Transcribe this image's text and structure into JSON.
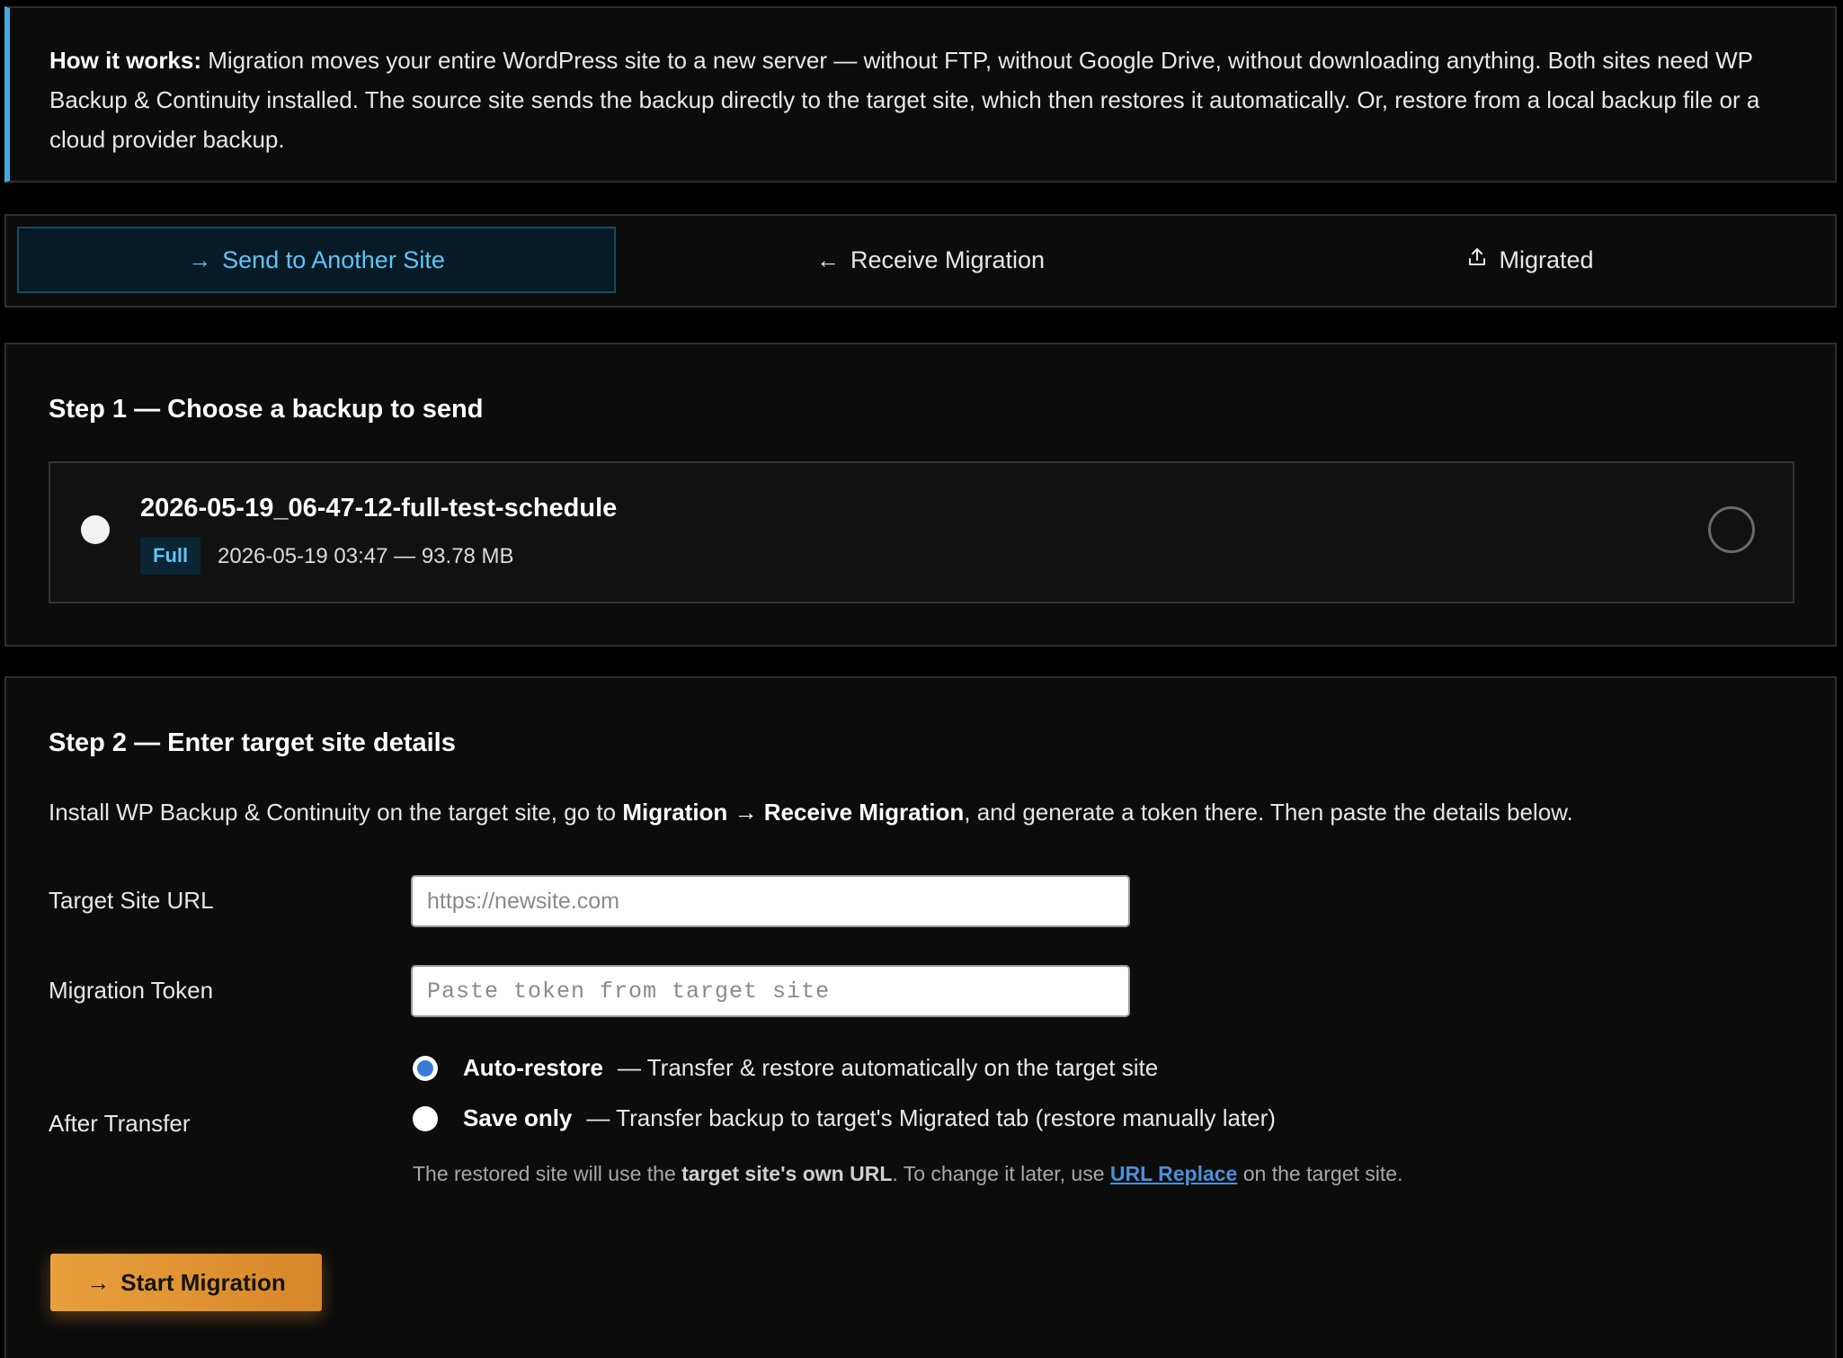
{
  "info": {
    "label": "How it works:",
    "text": " Migration moves your entire WordPress site to a new server — without FTP, without Google Drive, without downloading anything. Both sites need WP Backup & Continuity installed. The source site sends the backup directly to the target site, which then restores it automatically. Or, restore from a local backup file or a cloud provider backup."
  },
  "tabs": [
    {
      "label": "Send to Another Site",
      "icon": "arrow-right-icon",
      "glyph": "→",
      "active": true
    },
    {
      "label": "Receive Migration",
      "icon": "arrow-left-icon",
      "glyph": "←",
      "active": false
    },
    {
      "label": "Migrated",
      "icon": "upload-icon",
      "glyph": "⇪",
      "active": false
    }
  ],
  "step1": {
    "title": "Step 1 — Choose a backup to send",
    "backup": {
      "name": "2026-05-19_06-47-12-full-test-schedule",
      "badge": "Full",
      "meta": "2026-05-19 03:47 — 93.78 MB"
    }
  },
  "step2": {
    "title": "Step 2 — Enter target site details",
    "desc_prefix": "Install WP Backup & Continuity on the target site, go to ",
    "desc_bold": "Migration → Receive Migration",
    "desc_suffix": ", and generate a token there. Then paste the details below.",
    "url_label": "Target Site URL",
    "url_placeholder": "https://newsite.com",
    "token_label": "Migration Token",
    "token_placeholder": "Paste token from target site",
    "after_label": "After Transfer",
    "options": [
      {
        "title": "Auto-restore",
        "desc": "— Transfer & restore automatically on the target site",
        "checked": true
      },
      {
        "title": "Save only",
        "desc": "— Transfer backup to target's Migrated tab (restore manually later)",
        "checked": false
      }
    ],
    "note_prefix": "The restored site will use the ",
    "note_bold": "target site's own URL",
    "note_mid": ". To change it later, use ",
    "note_link": "URL Replace",
    "note_suffix": " on the target site.",
    "start_label": "Start Migration",
    "start_glyph": "→"
  },
  "colors": {
    "accent": "#5ec4f5",
    "info_border": "#4aa8e0",
    "button": "#e8a03c",
    "link": "#4a90d9",
    "radio_checked": "#3b7bd6"
  }
}
